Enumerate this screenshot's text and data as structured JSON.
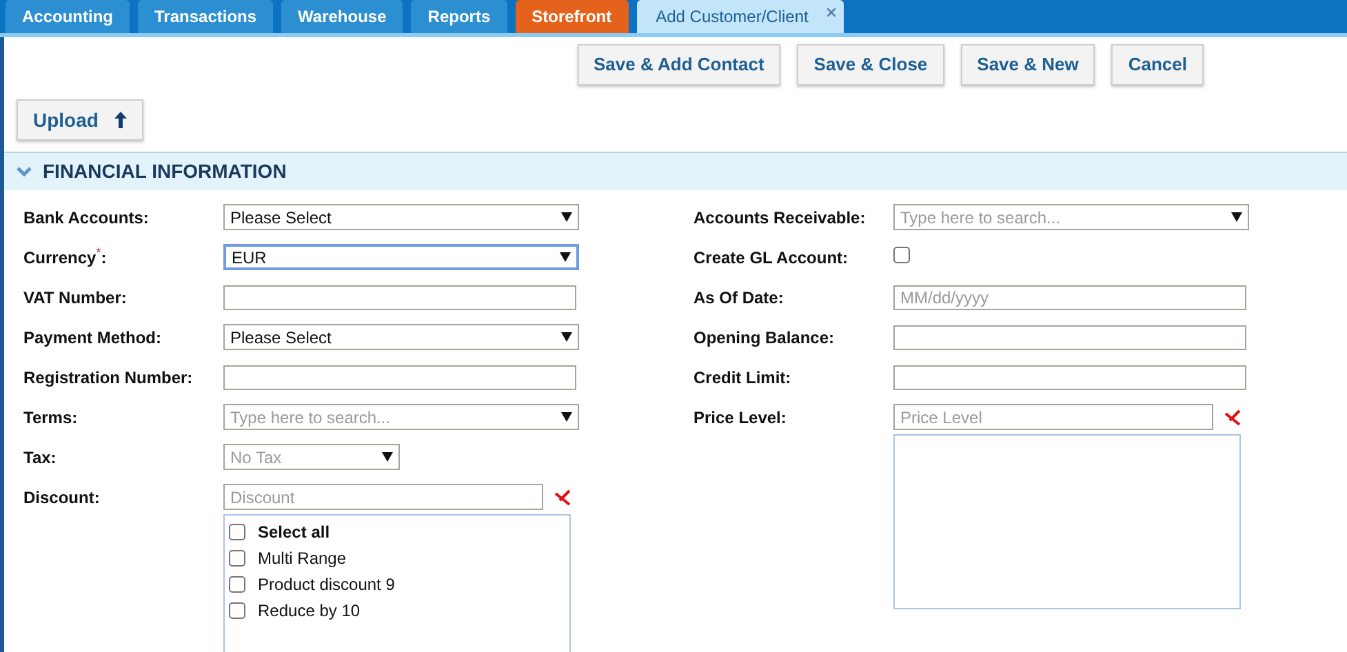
{
  "tabs": [
    {
      "label": "Accounting",
      "selected": false,
      "color": "#2b8fd1",
      "closable": false
    },
    {
      "label": "Transactions",
      "selected": false,
      "color": "#2b8fd1",
      "closable": false
    },
    {
      "label": "Warehouse",
      "selected": false,
      "color": "#2b8fd1",
      "closable": false
    },
    {
      "label": "Reports",
      "selected": false,
      "color": "#2b8fd1",
      "closable": false
    },
    {
      "label": "Storefront",
      "selected": false,
      "color": "#e4621c",
      "closable": false
    },
    {
      "label": "Add Customer/Client",
      "selected": true,
      "color": "#c3e5fa",
      "closable": true
    }
  ],
  "buttons": [
    "Save & Add Contact",
    "Save & Close",
    "Save & New",
    "Cancel"
  ],
  "upload": {
    "label": "Upload"
  },
  "section": {
    "title": "FINANCIAL INFORMATION",
    "expanded": true
  },
  "left_fields": [
    {
      "label": "Bank Accounts:",
      "kind": "select",
      "value": "Please Select",
      "focused": false
    },
    {
      "label": "Currency$^{*}$:",
      "kind": "select",
      "value": "EUR",
      "focused": true
    },
    {
      "label": "VAT Number:",
      "kind": "text",
      "focused": false
    },
    {
      "label": "Payment Method:",
      "kind": "select",
      "value": "Please Select",
      "focused": false
    },
    {
      "label": "Registration Number:",
      "kind": "text",
      "focused": false
    },
    {
      "label": "Terms:",
      "kind": "search",
      "placeholder": "Type here to search...",
      "focused": false
    },
    {
      "label": "Tax:",
      "kind": "small_select",
      "placeholder": "No Tax",
      "focused": false
    },
    {
      "label": "Discount:",
      "kind": "multiselect",
      "placeholder": "Discount",
      "focused": false,
      "options": [
        {
          "label": "Select all",
          "kind": "select_all",
          "checked": false
        },
        {
          "label": "Multi Range",
          "kind": "option",
          "checked": false
        },
        {
          "label": "Product discount 9",
          "kind": "option",
          "checked": false
        },
        {
          "label": "Reduce by 10",
          "kind": "option",
          "checked": false
        }
      ]
    }
  ],
  "right_fields": [
    {
      "label": "Accounts Receivable:",
      "kind": "search",
      "placeholder": "Type here to search..."
    },
    {
      "label": "Create GL Account:",
      "kind": "checkbox",
      "checked": false
    },
    {
      "label": "As Of Date:",
      "kind": "text",
      "placeholder": "MM/dd/yyyy"
    },
    {
      "label": "Opening Balance:",
      "kind": "text"
    },
    {
      "label": "Credit Limit:",
      "kind": "text"
    },
    {
      "label": "Price Level:",
      "kind": "multiselect",
      "placeholder": "Price Level"
    }
  ]
}
